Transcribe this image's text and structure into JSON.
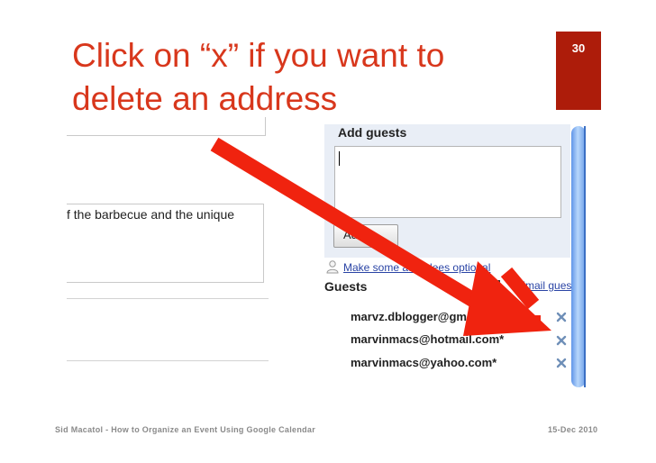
{
  "slide": {
    "title_line1": "Click on “x” if you want to",
    "title_line2": "delete an address",
    "page_number": "30",
    "footer_left": "Sid Macatol - How to Organize an Event Using Google Calendar",
    "footer_right": "15-Dec 2010",
    "accent_color": "#d8371c",
    "page_box_color": "#ad1c0a"
  },
  "event_form": {
    "description_text": "f the barbecue and the unique"
  },
  "guest_panel": {
    "add_guests_label": "Add guests",
    "guest_input_value": "",
    "add_button_label": "Add",
    "optional_link": "Make some attendees optional",
    "guests_heading": "Guests",
    "email_guests_link": "Email guests",
    "guests": [
      {
        "email": "marvz.dblogger@gmail.com"
      },
      {
        "email": "marvinmacs@hotmail.com*"
      },
      {
        "email": "marvinmacs@yahoo.com*"
      }
    ]
  },
  "icons": {
    "person": "person-icon",
    "email": "envelope-icon",
    "remove": "remove-x-icon",
    "arrow": "red-arrow"
  }
}
